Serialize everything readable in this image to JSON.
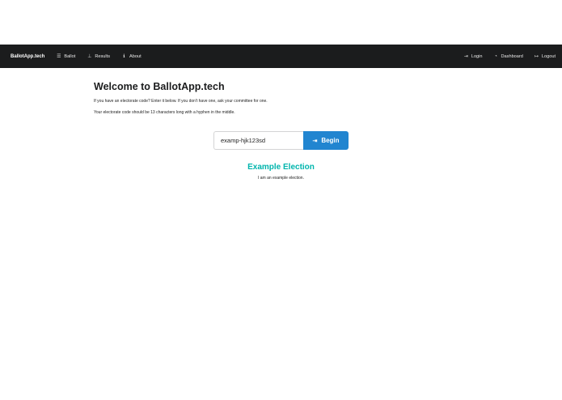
{
  "navbar": {
    "brand": "BallotApp.tech",
    "left_items": [
      {
        "label": "Ballot",
        "icon": "list-icon",
        "glyph": "☰"
      },
      {
        "label": "Results",
        "icon": "sitemap-icon",
        "glyph": "⊥"
      },
      {
        "label": "About",
        "icon": "info-icon",
        "glyph": "ℹ"
      }
    ],
    "right_items": [
      {
        "label": "Login",
        "icon": "sign-in-icon",
        "glyph": "⇥"
      },
      {
        "label": "Dashboard",
        "icon": "dashboard-icon",
        "glyph": "◔"
      },
      {
        "label": "Logout",
        "icon": "sign-out-icon",
        "glyph": "↦"
      }
    ]
  },
  "main": {
    "title": "Welcome to BallotApp.tech",
    "paragraphs": [
      "If you have an electorate code? Enter it below. If you don't have one, ask your committee for one.",
      "Your electorate code should be 13 characters long with a hyphen in the middle."
    ],
    "code_input_value": "examp-hjk123sd",
    "begin_label": "Begin",
    "begin_glyph": "⇥"
  },
  "election": {
    "title": "Example Election",
    "description": "I am an example election."
  },
  "colors": {
    "navbar_bg": "#1b1c1d",
    "primary": "#2185d0",
    "teal": "#00b5ad"
  }
}
